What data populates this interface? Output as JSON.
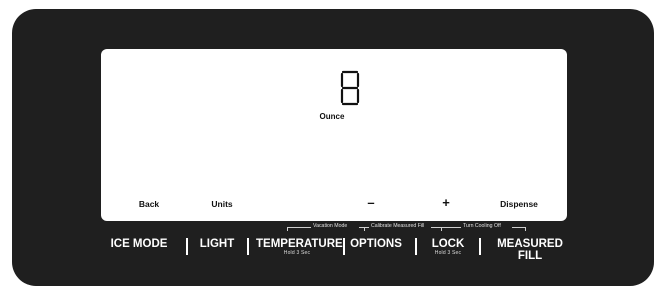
{
  "display": {
    "unit": "Ounce"
  },
  "touch_buttons": {
    "back": "Back",
    "units": "Units",
    "minus": "–",
    "plus": "+",
    "dispense": "Dispense"
  },
  "control_bar": {
    "ice_mode": "ICE MODE",
    "light": "LIGHT",
    "temperature": "TEMPERATURE",
    "temperature_hold": "Hold 3 Sec",
    "options": "OPTIONS",
    "lock": "LOCK",
    "lock_hold": "Hold 3 Sec",
    "measured_fill": "MEASURED FILL"
  },
  "combo_hints": {
    "vacation_mode": "Vacation Mode",
    "calibrate_measured_fill": "Calibrate Measured Fill",
    "turn_cooling_off": "Turn Cooling Off"
  }
}
